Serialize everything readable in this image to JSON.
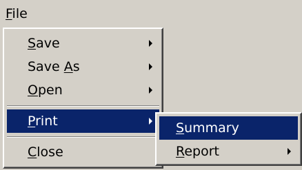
{
  "menubar": {
    "title": {
      "before": "",
      "accel": "F",
      "after": "ile"
    }
  },
  "menu": {
    "items": [
      {
        "before": "",
        "accel": "S",
        "after": "ave",
        "has_submenu": true
      },
      {
        "before": "Save ",
        "accel": "A",
        "after": "s",
        "has_submenu": true
      },
      {
        "before": "",
        "accel": "O",
        "after": "pen",
        "has_submenu": true
      },
      {
        "before": "",
        "accel": "P",
        "after": "rint",
        "has_submenu": true,
        "highlighted": true
      },
      {
        "before": "",
        "accel": "C",
        "after": "lose",
        "has_submenu": false
      }
    ]
  },
  "submenu": {
    "items": [
      {
        "before": "",
        "accel": "S",
        "after": "ummary",
        "has_submenu": false,
        "highlighted": true
      },
      {
        "before": "",
        "accel": "R",
        "after": "eport",
        "has_submenu": true
      }
    ]
  },
  "colors": {
    "face": "#d4d0c8",
    "highlight": "#0a246a",
    "highlight_text": "#ffffff"
  }
}
